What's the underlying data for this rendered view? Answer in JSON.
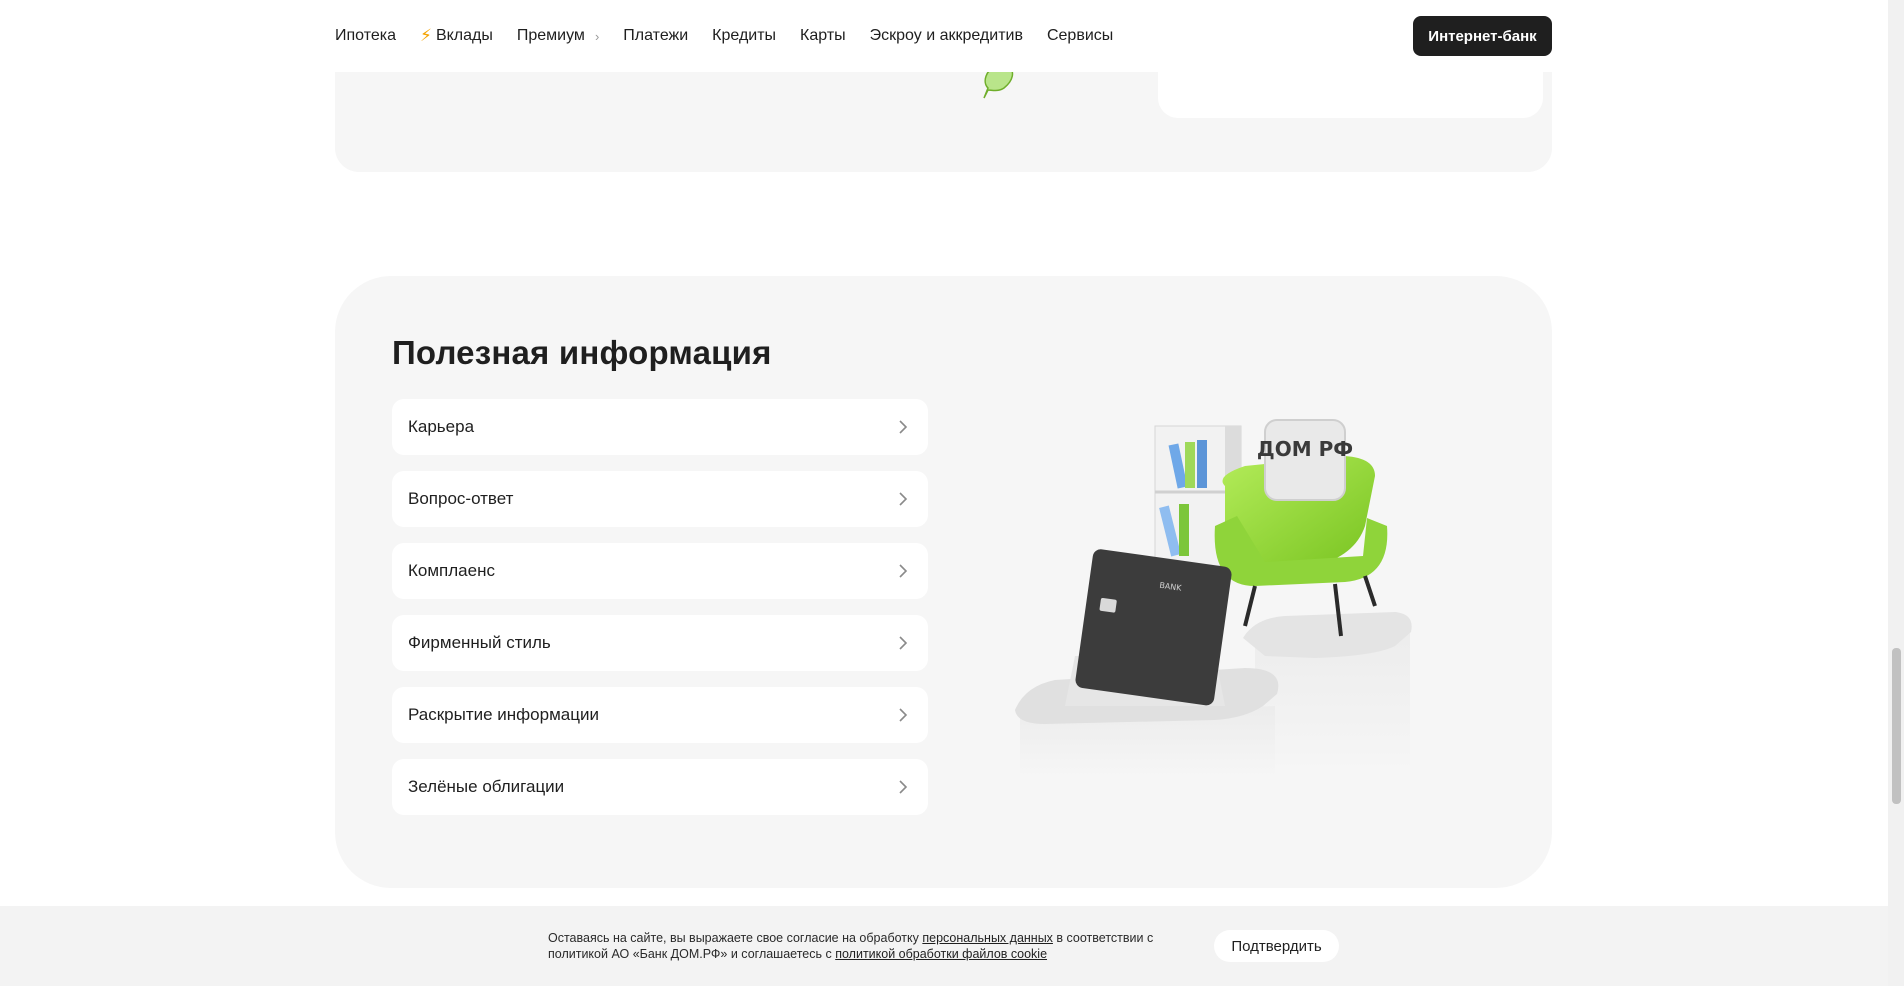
{
  "header": {
    "nav": [
      "Ипотека",
      "Вклады",
      "Премиум",
      "Платежи",
      "Кредиты",
      "Карты",
      "Эскроу и аккредитив",
      "Сервисы"
    ],
    "internet_bank": "Интернет-банк"
  },
  "info": {
    "title": "Полезная информация",
    "links": [
      "Карьера",
      "Вопрос-ответ",
      "Комплаенс",
      "Фирменный стиль",
      "Раскрытие информации",
      "Зелёные облигации"
    ],
    "illustration": {
      "logo_text": "ДОМ РФ",
      "card_text": "BANK"
    }
  },
  "cookie": {
    "text_1": "Оставаясь на сайте, вы выражаете свое согласие на обработку",
    "link_1": "персональных данных",
    "text_2": "в соответствии с политикой АО «Банк ДОМ.РФ» и соглашаетесь с",
    "link_2": "политикой обработки файлов cookie",
    "confirm": "Подтвердить"
  },
  "colors": {
    "accent_green": "#8ed62c",
    "dark": "#1f1f1f",
    "section_bg": "#f6f6f6",
    "bolt": "#f5a300"
  }
}
